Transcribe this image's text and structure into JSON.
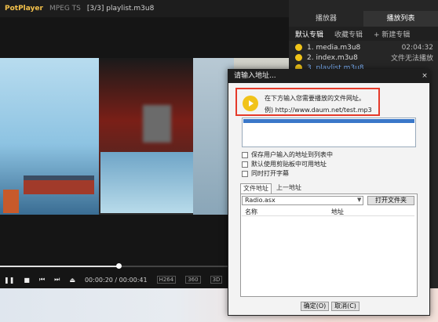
{
  "player": {
    "app_name": "PotPlayer",
    "format": "MPEG TS",
    "file_title": "[3/3] playlist.m3u8",
    "time": "00:00:20 / 00:00:41",
    "codec_badge": "H264",
    "badge_3d": "3D",
    "badge_360": "360"
  },
  "playlist": {
    "tabs": [
      "播放器",
      "播放列表"
    ],
    "subtabs": [
      "默认专辑",
      "收藏专辑",
      "+ 新建专辑"
    ],
    "items": [
      {
        "label": "1. media.m3u8",
        "duration": "02:04:32"
      },
      {
        "label": "2. index.m3u8",
        "duration": "文件无法播放"
      },
      {
        "label": "3. playlist.m3u8",
        "duration": ""
      }
    ]
  },
  "dialog": {
    "title": "请输入地址...",
    "hint_line1": "在下方输入您需要播放的文件网址。",
    "hint_line2": "例) http://www.daum.net/test.mp3",
    "checkboxes": [
      "保存用户输入的地址到列表中",
      "默认使用剪贴板中可用地址",
      "同时打开字幕"
    ],
    "tabs": [
      "文件地址",
      "上一地址"
    ],
    "combo_value": "Radio.asx",
    "open_folder_label": "打开文件夹",
    "columns": [
      "名称",
      "地址"
    ],
    "ok_label": "确定(O)",
    "cancel_label": "取消(C)"
  }
}
